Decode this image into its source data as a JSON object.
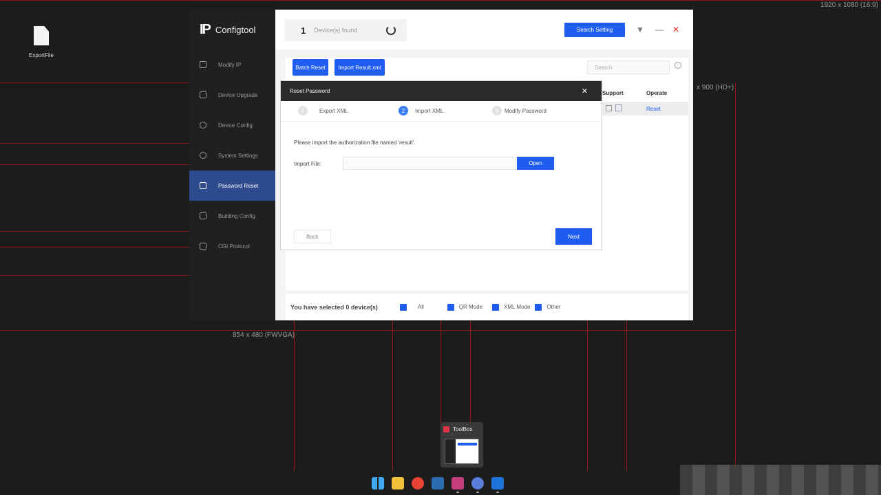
{
  "desktop": {
    "file_icon_label": "ExportFile",
    "resolution_labels": {
      "top_right": "1920 x 1080 (16:9)",
      "hd_plus": "x 900 (HD+)",
      "fwvga": "854 x 480 (FWVGA)"
    },
    "guide_color": "#8b1a1a"
  },
  "app": {
    "brand": "Configtool",
    "logo_text": "IP",
    "sidebar": {
      "items": [
        {
          "label": "Modify IP",
          "icon": "modify-ip-icon"
        },
        {
          "label": "Device Upgrade",
          "icon": "upgrade-icon"
        },
        {
          "label": "Device Config",
          "icon": "config-icon"
        },
        {
          "label": "System Settings",
          "icon": "settings-icon"
        },
        {
          "label": "Password Reset",
          "icon": "lock-icon",
          "active": true
        },
        {
          "label": "Building Config",
          "icon": "building-icon"
        },
        {
          "label": "CGI Protocol",
          "icon": "cgi-icon"
        }
      ]
    },
    "topbar": {
      "device_count": "1",
      "device_found_text": "Device(s) found",
      "search_setting_label": "Search Setting"
    },
    "toolbar": {
      "batch_reset_label": "Batch Reset",
      "import_result_label": "Import Result.xml",
      "search_placeholder": "Search"
    },
    "table": {
      "columns": [
        "Support",
        "Operate"
      ],
      "rows": [
        {
          "operate": "Reset"
        }
      ]
    },
    "bottombar": {
      "selected_text": "You have selected 0  device(s)",
      "filters": [
        "All",
        "QR Mode",
        "XML Mode",
        "Other"
      ]
    },
    "accent_color": "#1f5cf0"
  },
  "dialog": {
    "title": "Reset Password",
    "steps": [
      {
        "num": "1",
        "label": "Export XML"
      },
      {
        "num": "2",
        "label": "Import XML",
        "active": true
      },
      {
        "num": "3",
        "label": "Modify Password"
      }
    ],
    "hint": "Please import the authorization file named 'result'.",
    "import_label": "Import File:",
    "open_label": "Open",
    "back_label": "Back",
    "next_label": "Next"
  },
  "taskbar": {
    "preview_title": "ToolBox"
  }
}
